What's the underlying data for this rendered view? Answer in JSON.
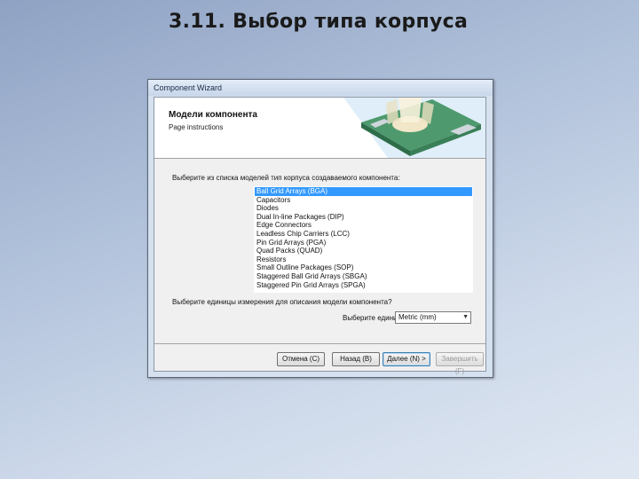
{
  "slide": {
    "title": "3.11. Выбор типа корпуса"
  },
  "window": {
    "title": "Component Wizard"
  },
  "page": {
    "heading": "Модели компонента",
    "subheading": "Page instructions"
  },
  "package_prompt": "Выберите из списка моделей тип корпуса создаваемого компонента:",
  "packages": {
    "items": [
      "Ball Grid Arrays (BGA)",
      "Capacitors",
      "Diodes",
      "Dual In-line Packages (DIP)",
      "Edge Connectors",
      "Leadless Chip Carriers (LCC)",
      "Pin Grid Arrays (PGA)",
      "Quad Packs (QUAD)",
      "Resistors",
      "Small Outline Packages (SOP)",
      "Staggered Ball Grid Arrays (SBGA)",
      "Staggered Pin Grid Arrays (SPGA)"
    ],
    "selected_index": 0
  },
  "units": {
    "prompt": "Выберите единицы измерения для описания модели компонента?",
    "label": "Выберите едини",
    "selected": "Metric (mm)"
  },
  "buttons": {
    "cancel": "Отмена (C)",
    "back": "Назад (B)",
    "next": "Далее (N) >",
    "finish": "Завершить (F)"
  },
  "colors": {
    "selection": "#3399ff",
    "background": "#aebfd9"
  }
}
